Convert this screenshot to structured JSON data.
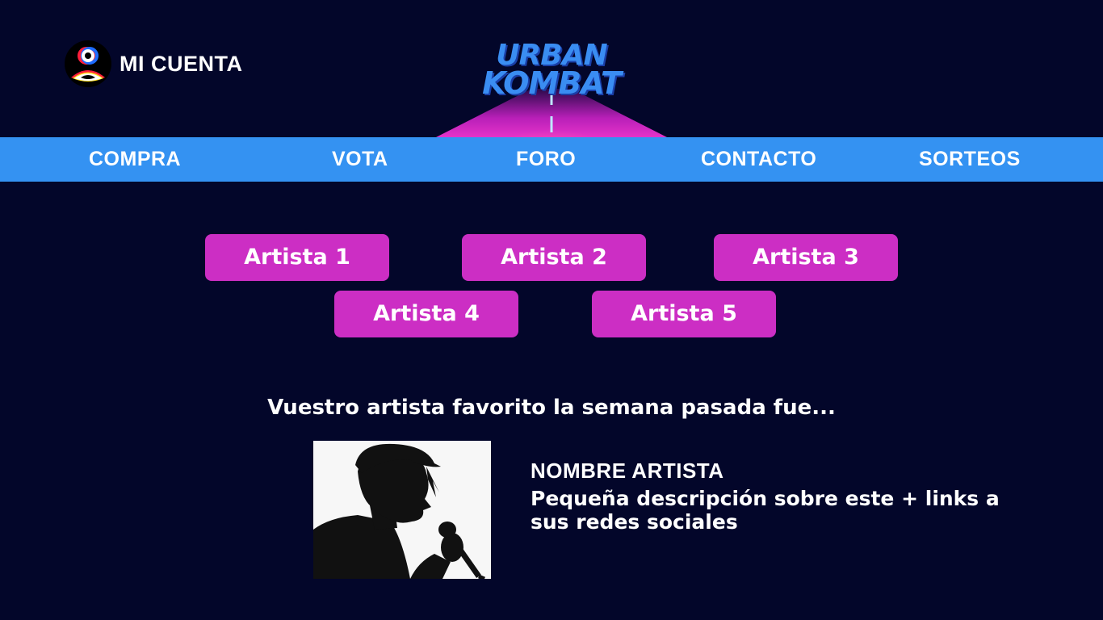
{
  "account": {
    "label": "MI CUENTA",
    "icon": "user-account-icon"
  },
  "logo": {
    "line1": "URBAN",
    "line2": "KOMBAT"
  },
  "nav": {
    "items": [
      {
        "label": "COMPRA"
      },
      {
        "label": "VOTA"
      },
      {
        "label": "FORO"
      },
      {
        "label": "CONTACTO"
      },
      {
        "label": "SORTEOS"
      }
    ]
  },
  "artists": {
    "buttons": [
      {
        "label": "Artista 1"
      },
      {
        "label": "Artista 2"
      },
      {
        "label": "Artista 3"
      },
      {
        "label": "Artista 4"
      },
      {
        "label": "Artista 5"
      }
    ]
  },
  "favorite": {
    "heading": "Vuestro artista favorito la semana pasada fue...",
    "name": "NOMBRE ARTISTA",
    "description": "Pequeña descripción sobre este + links a sus redes sociales",
    "photo_icon": "singer-silhouette-image"
  },
  "colors": {
    "background": "#03062a",
    "nav_bar": "#3492f2",
    "artist_button": "#cc2ec4",
    "logo_text": "#3a8df2"
  }
}
